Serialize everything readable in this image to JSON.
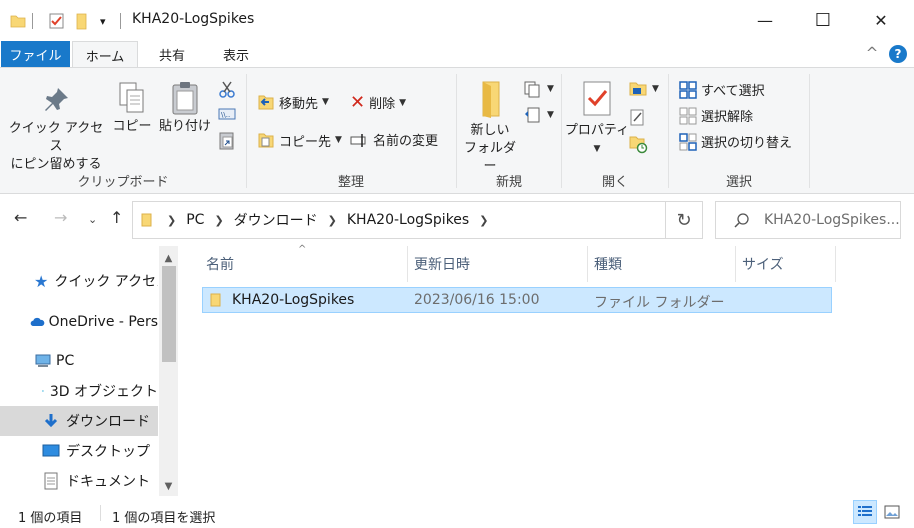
{
  "window": {
    "title": "KHA20-LogSpikes",
    "minimize_glyph": "—",
    "maximize_glyph": "☐",
    "close_glyph": "✕"
  },
  "quick_access": {
    "dropdown_glyph": "▾"
  },
  "tabs": {
    "file": "ファイル",
    "home": "ホーム",
    "share": "共有",
    "view": "表示",
    "collapse_glyph": "^",
    "help_glyph": "?"
  },
  "ribbon": {
    "clipboard": {
      "label": "クリップボード",
      "pin_line1": "クイック アクセス",
      "pin_line2": "にピン留めする",
      "copy": "コピー",
      "paste": "貼り付け"
    },
    "organize": {
      "label": "整理",
      "move_to": "移動先",
      "copy_to": "コピー先",
      "delete": "削除",
      "rename": "名前の変更"
    },
    "new": {
      "label": "新規",
      "new_folder_line1": "新しい",
      "new_folder_line2": "フォルダー"
    },
    "open": {
      "label": "開く",
      "properties": "プロパティ"
    },
    "select": {
      "label": "選択",
      "select_all": "すべて選択",
      "select_none": "選択解除",
      "invert_selection": "選択の切り替え"
    }
  },
  "address": {
    "segments": [
      "PC",
      "ダウンロード",
      "KHA20-LogSpikes"
    ],
    "search_placeholder": "KHA20-LogSpikes..."
  },
  "nav_pane": {
    "items": [
      {
        "label": "クイック アクセス",
        "icon": "star-icon"
      },
      {
        "label": "OneDrive - Pers",
        "icon": "cloud-icon"
      },
      {
        "label": "PC",
        "icon": "computer-icon"
      },
      {
        "label": "3D オブジェクト",
        "icon": "cube-icon"
      },
      {
        "label": "ダウンロード",
        "icon": "download-icon"
      },
      {
        "label": "デスクトップ",
        "icon": "desktop-icon"
      },
      {
        "label": "ドキュメント",
        "icon": "document-icon"
      }
    ]
  },
  "file_list": {
    "columns": [
      "名前",
      "更新日時",
      "種類",
      "サイズ"
    ],
    "rows": [
      {
        "name": "KHA20-LogSpikes",
        "modified": "2023/06/16 15:00",
        "type": "ファイル フォルダー",
        "size": ""
      }
    ]
  },
  "status": {
    "item_count": "1 個の項目",
    "selected_count": "1 個の項目を選択"
  },
  "colors": {
    "accent": "#1979ca",
    "selection": "#cce8ff",
    "folder": "#f8d775"
  }
}
